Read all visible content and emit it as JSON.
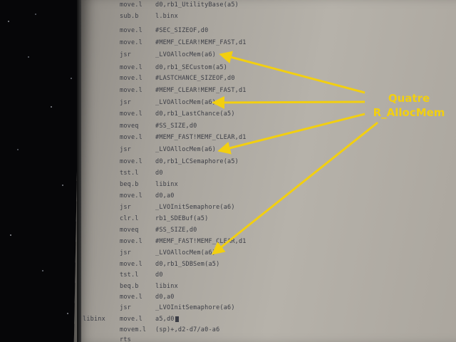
{
  "annotation": {
    "line1": "Quatre",
    "line2": "R_AllocMem",
    "color": "#f2cf10"
  },
  "code_lines": [
    {
      "label": "",
      "op": "move.l",
      "args": "d0,rb1_UtilityBase(a5)"
    },
    {
      "label": "",
      "op": "sub.b",
      "args": "l.binx"
    },
    {
      "label": "",
      "op": "move.l",
      "args": "#SEC_SIZEOF,d0"
    },
    {
      "label": "",
      "op": "move.l",
      "args": "#MEMF_CLEAR!MEMF_FAST,d1"
    },
    {
      "label": "",
      "op": "jsr",
      "args": "_LVOAllocMem(a6)"
    },
    {
      "label": "",
      "op": "move.l",
      "args": "d0,rb1_SECustom(a5)"
    },
    {
      "label": "",
      "op": "move.l",
      "args": "#LASTCHANCE_SIZEOF,d0"
    },
    {
      "label": "",
      "op": "move.l",
      "args": "#MEMF_CLEAR!MEMF_FAST,d1"
    },
    {
      "label": "",
      "op": "jsr",
      "args": "_LVOAllocMem(a6)"
    },
    {
      "label": "",
      "op": "move.l",
      "args": "d0,rb1_LastChance(a5)"
    },
    {
      "label": "",
      "op": "moveq",
      "args": "#SS_SIZE,d0"
    },
    {
      "label": "",
      "op": "move.l",
      "args": "#MEMF_FAST!MEMF_CLEAR,d1"
    },
    {
      "label": "",
      "op": "jsr",
      "args": "_LVOAllocMem(a6)"
    },
    {
      "label": "",
      "op": "move.l",
      "args": "d0,rb1_LCSemaphore(a5)"
    },
    {
      "label": "",
      "op": "tst.l",
      "args": "d0"
    },
    {
      "label": "",
      "op": "beq.b",
      "args": "libinx"
    },
    {
      "label": "",
      "op": "move.l",
      "args": "d0,a0"
    },
    {
      "label": "",
      "op": "jsr",
      "args": "_LVOInitSemaphore(a6)"
    },
    {
      "label": "",
      "op": "clr.l",
      "args": "rb1_SDEBuf(a5)"
    },
    {
      "label": "",
      "op": "moveq",
      "args": "#SS_SIZE,d0"
    },
    {
      "label": "",
      "op": "move.l",
      "args": "#MEMF_FAST!MEMF_CLEAR,d1"
    },
    {
      "label": "",
      "op": "jsr",
      "args": "_LVOAllocMem(a6)"
    },
    {
      "label": "",
      "op": "move.l",
      "args": "d0,rb1_SDBSem(a5)"
    },
    {
      "label": "",
      "op": "tst.l",
      "args": "d0"
    },
    {
      "label": "",
      "op": "beq.b",
      "args": "libinx"
    },
    {
      "label": "",
      "op": "move.l",
      "args": "d0,a0"
    },
    {
      "label": "",
      "op": "jsr",
      "args": "_LVOInitSemaphore(a6)"
    },
    {
      "label": "libinx",
      "op": "move.l",
      "args": "a5,d0"
    },
    {
      "label": "",
      "op": "movem.l",
      "args": "(sp)+,d2-d7/a0-a6"
    },
    {
      "label": "",
      "op": "rts",
      "args": ""
    }
  ]
}
